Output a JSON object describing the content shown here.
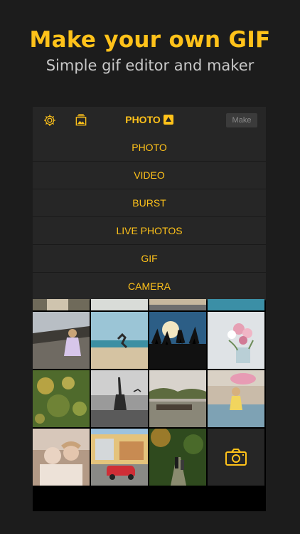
{
  "promo": {
    "headline": "Make your own GIF",
    "subline": "Simple gif editor and maker"
  },
  "nav": {
    "settings_icon": "gear-icon",
    "album_icon": "album-icon",
    "title": "PHOTO",
    "make_label": "Make"
  },
  "menu": {
    "items": [
      {
        "label": "PHOTO"
      },
      {
        "label": "VIDEO"
      },
      {
        "label": "BURST"
      },
      {
        "label": "LIVE PHOTOS"
      },
      {
        "label": "GIF"
      },
      {
        "label": "CAMERA"
      }
    ]
  },
  "colors": {
    "accent": "#ffc21a",
    "background": "#1c1c1c",
    "panel": "#262626"
  },
  "grid": {
    "camera_icon": "camera-icon"
  }
}
